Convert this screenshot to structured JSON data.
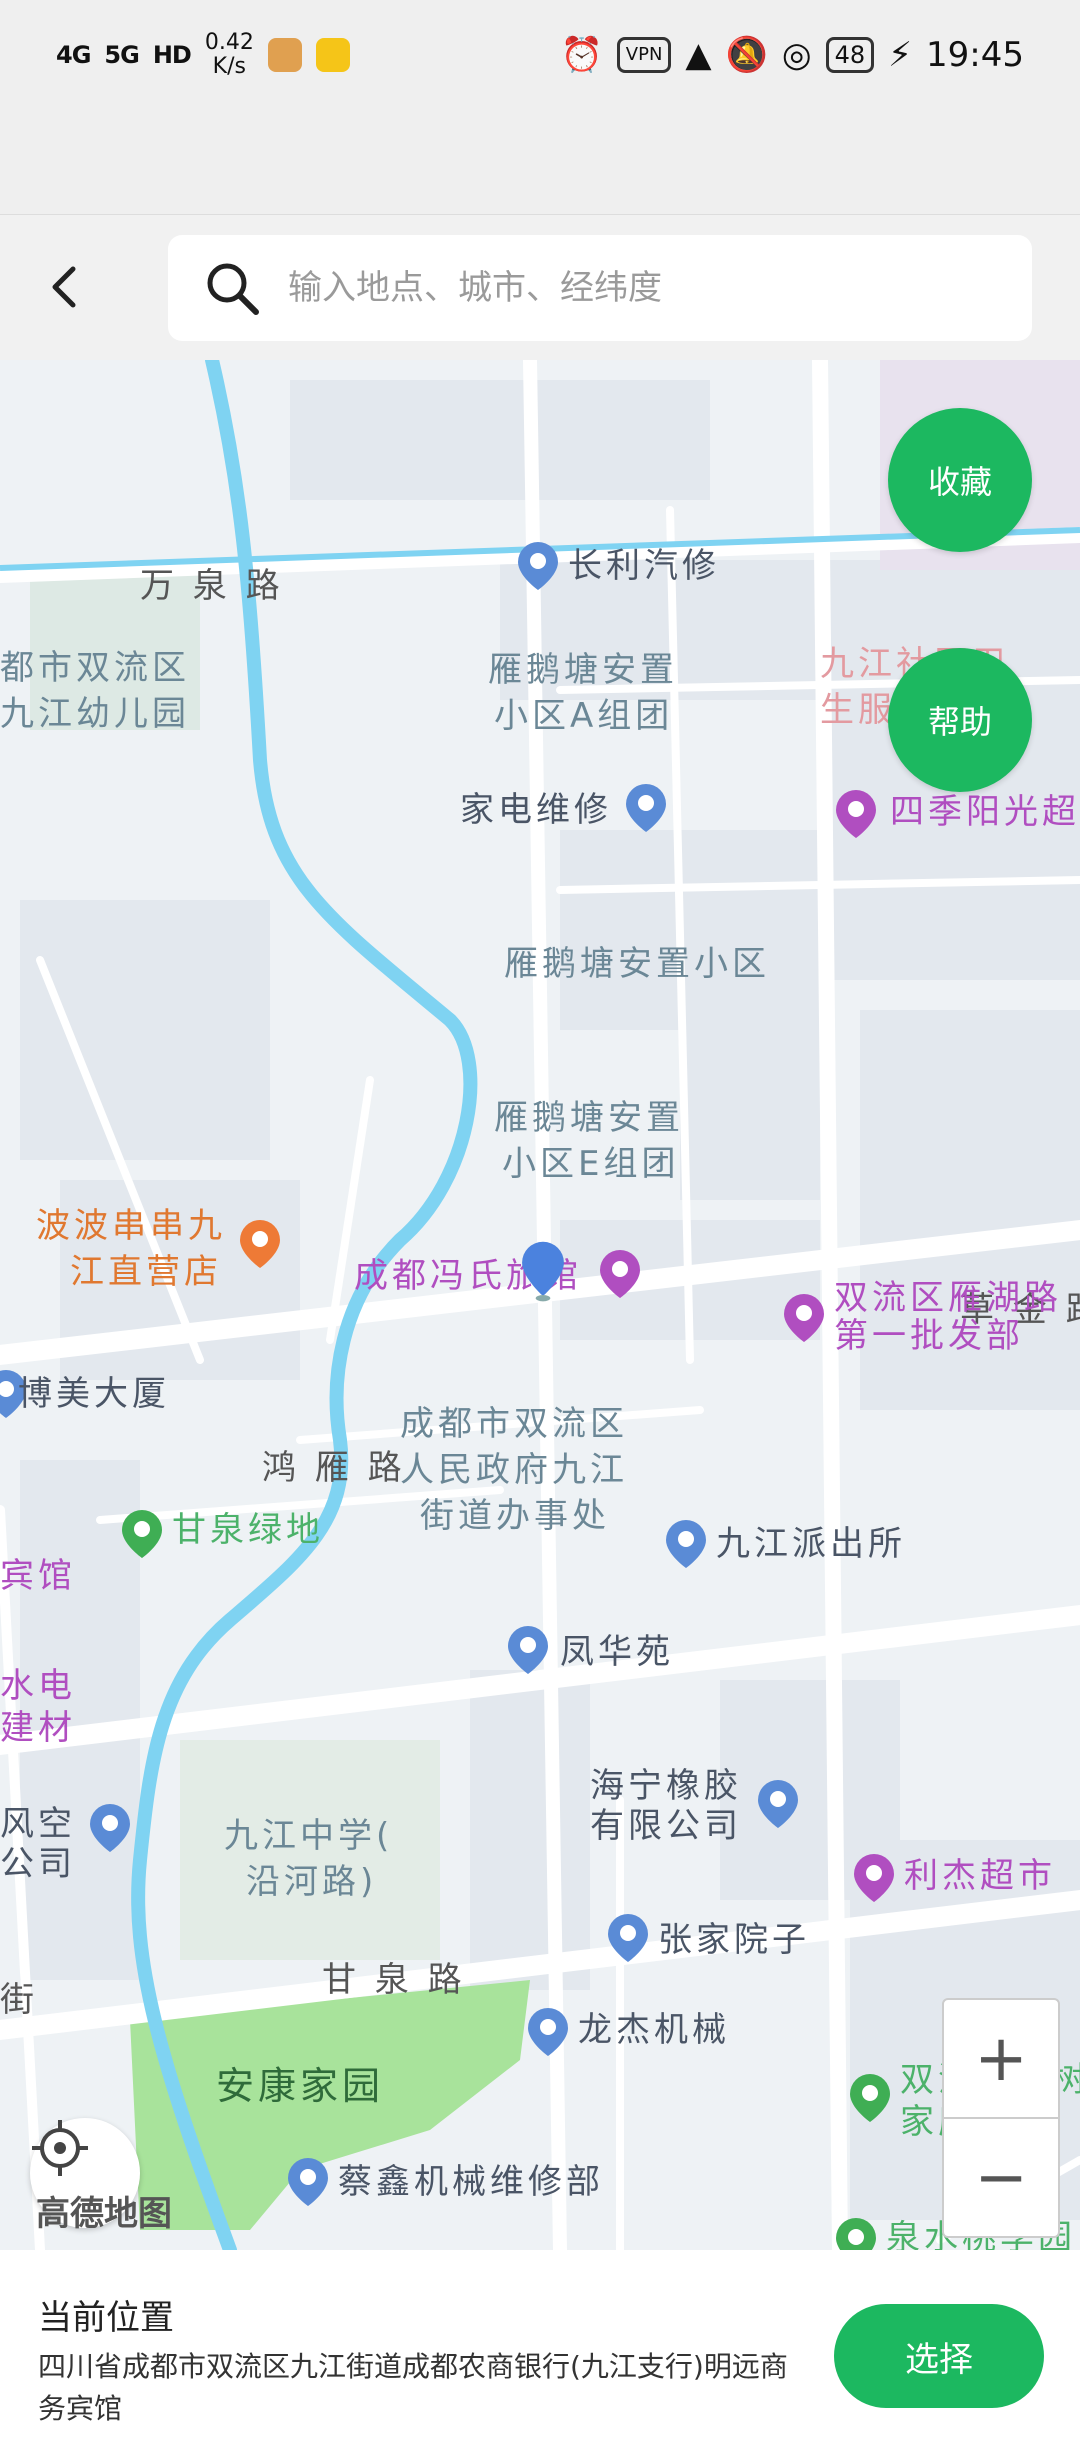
{
  "status": {
    "signal1": "4G",
    "signal2": "5G",
    "hd": "HD",
    "speed": "0.42",
    "speed_unit": "K/s",
    "vpn": "VPN",
    "battery": "48",
    "time": "19:45"
  },
  "search": {
    "placeholder": "输入地点、城市、经纬度"
  },
  "buttons": {
    "favorite": "收藏",
    "help": "帮助",
    "select": "选择",
    "zoom_in": "+",
    "zoom_out": "−"
  },
  "map": {
    "brand": "高德地图",
    "roads": {
      "wanquan": "万 泉 路",
      "hongyan": "鸿 雁 路",
      "ganquan": "甘 泉 路",
      "caojin": "草 金 路",
      "jie": "街"
    },
    "areas": {
      "kindergarten_1": "都市双流区",
      "kindergarten_2": "九江幼儿园",
      "yanetang_a1": "雁鹅塘安置",
      "yanetang_a2": "小区A组团",
      "yanetang": "雁鹅塘安置小区",
      "yanetang_e1": "雁鹅塘安置",
      "yanetang_e2": "小区E组团",
      "gov_1": "成都市双流区",
      "gov_2": "人民政府九江",
      "gov_3": "街道办事处",
      "school_1": "九江中学(",
      "school_2": "沿河路)",
      "jiujiang_health_1": "九江社区卫",
      "jiujiang_health_2": "生服务中心",
      "ankang": "安康家园"
    },
    "pois": {
      "changli": "长利汽修",
      "appliance": "家电维修",
      "siji": "四季阳光超",
      "bobo_1": "波波串串九",
      "bobo_2": "江直营店",
      "hotel": "成都冯氏旅馆",
      "yanhu_1": "双流区雁湖路",
      "yanhu_2": "第一批发部",
      "bomei": "博美大厦",
      "ganquan_green": "甘泉绿地",
      "police": "九江派出所",
      "fenghua": "凤华苑",
      "haining_1": "海宁橡胶",
      "haining_2": "有限公司",
      "lijie": "利杰超市",
      "zhangjia": "张家院子",
      "longjie": "龙杰机械",
      "caixin": "蔡鑫机械维修部",
      "orchard_1": "双流区果树",
      "orchard_2": "家庭农场",
      "quanshui": "泉水桃李园",
      "guan": "宾馆",
      "shuidian_1": "水电",
      "shuidian_2": "建材",
      "fengkong_1": "风空",
      "fengkong_2": "公司"
    }
  },
  "current": {
    "title": "当前位置",
    "address": "四川省成都市双流区九江街道成都农商银行(九江支行)明远商务宾馆"
  },
  "colors": {
    "accent": "#1cb860",
    "river": "#7fd3f2",
    "park": "#a8e39b"
  }
}
